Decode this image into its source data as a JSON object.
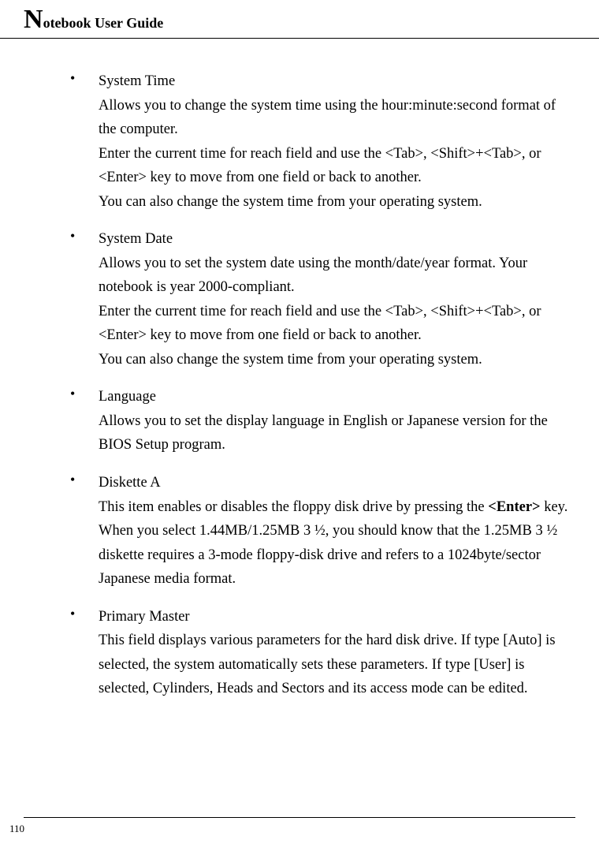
{
  "header": {
    "big_letter": "N",
    "rest": "otebook User Guide"
  },
  "items": [
    {
      "title": "System Time",
      "body_html": "Allows you to change the system time using the hour:minute:second format of the computer.<br>Enter the current time for reach field and use the &lt;Tab&gt;, &lt;Shift&gt;+&lt;Tab&gt;, or &lt;Enter&gt; key to move from one field or back to another.<br>You can also change the system time from your operating system."
    },
    {
      "title": "System Date",
      "body_html": "Allows you to set the system date using the month/date/year format. Your notebook is year 2000-compliant.<br>Enter the current time for reach field and use the &lt;Tab&gt;, &lt;Shift&gt;+&lt;Tab&gt;, or &lt;Enter&gt; key to move from one field or back to another.<br>You can also change the system time from your operating system."
    },
    {
      "title": "Language",
      "body_html": "Allows you to set the display language in English or Japanese version for the BIOS Setup program."
    },
    {
      "title": "Diskette A",
      "body_html": "This item enables or disables the floppy disk drive by pressing the <span class=\"bold\">&lt;Enter&gt;</span> key. When you select 1.44MB/1.25MB 3 ½, you should know that the 1.25MB 3 ½ diskette requires a 3-mode floppy-disk drive and refers to a 1024byte/sector Japanese media format."
    },
    {
      "title": "Primary Master",
      "body_html": "This field displays various parameters for the hard disk drive. If type [Auto] is selected, the system automatically sets these parameters. If type [User] is selected, Cylinders, Heads and Sectors and its access mode can be edited."
    }
  ],
  "page_number": "110"
}
